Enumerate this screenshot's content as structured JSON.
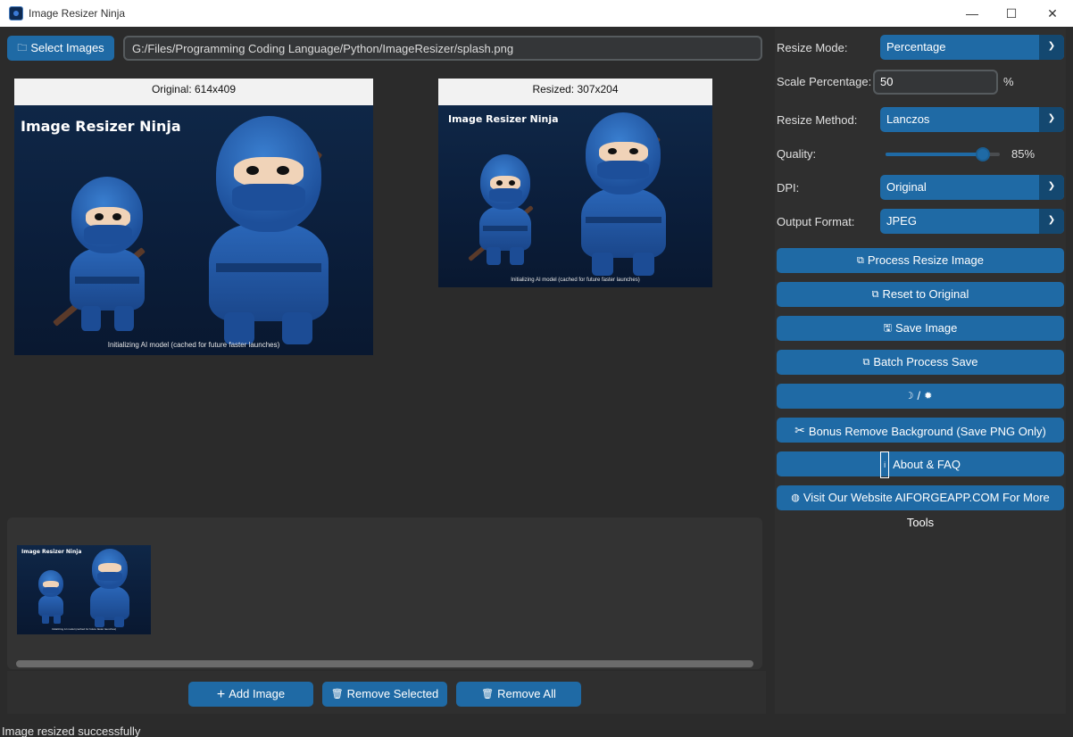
{
  "window": {
    "title": "Image Resizer Ninja",
    "minimize": "—",
    "maximize": "☐",
    "close": "✕"
  },
  "toolbar": {
    "select_images_label": "Select Images",
    "path_value": "G:/Files/Programming Coding Language/Python/ImageResizer/splash.png"
  },
  "preview": {
    "original_label": "Original: 614x409",
    "resized_label": "Resized: 307x204",
    "image_brand": "Image Resizer Ninja",
    "image_caption": "Initializing AI model (cached for future faster launches)"
  },
  "thumbnails": {
    "brand": "Image Resizer Ninja",
    "caption": "Initializing AI model (cached for future faster launches)"
  },
  "bottom_buttons": {
    "add_image": "Add Image",
    "remove_selected": "Remove Selected",
    "remove_all": "Remove All"
  },
  "status": "Image resized successfully",
  "settings": {
    "resize_mode_label": "Resize Mode:",
    "resize_mode_value": "Percentage",
    "scale_percentage_label": "Scale Percentage:",
    "scale_percentage_value": "50",
    "scale_unit": "%",
    "resize_method_label": "Resize Method:",
    "resize_method_value": "Lanczos",
    "quality_label": "Quality:",
    "quality_value": "85%",
    "quality_fraction": 0.85,
    "dpi_label": "DPI:",
    "dpi_value": "Original",
    "output_format_label": "Output Format:",
    "output_format_value": "JPEG"
  },
  "actions": {
    "process_resize": "Process Resize Image",
    "reset": "Reset to Original",
    "save": "Save Image",
    "batch": "Batch Process Save",
    "theme_toggle": "/",
    "remove_background": "Bonus Remove Background (Save PNG Only)",
    "about": "About & FAQ",
    "website": "Visit Our Website AIFORGEAPP.COM For More Tools"
  },
  "colors": {
    "accent": "#1f6aa5",
    "background": "#2b2b2b"
  }
}
